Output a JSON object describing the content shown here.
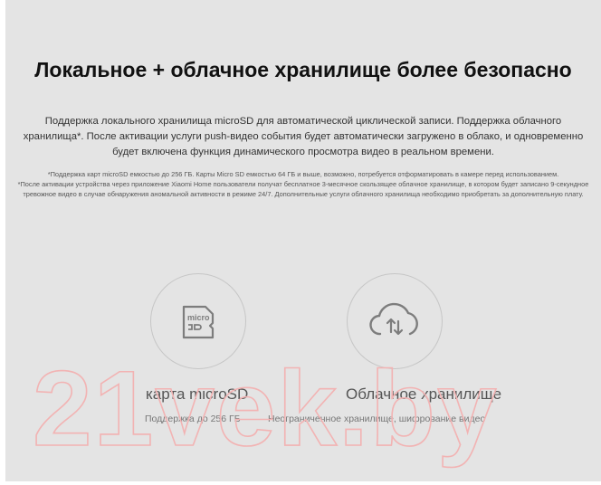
{
  "heading": "Локальное + облачное хранилище более безопасно",
  "description": "Поддержка локального хранилища microSD для автоматической циклической записи. Поддержка облачного хранилища*. После активации услуги push-видео события будет автоматически загружено в облако, и одновременно будет включена функция динамического просмотра видео в реальном времени.",
  "footnotes": [
    "*Поддержка карт microSD емкостью до 256 ГБ. Карты Micro SD емкостью 64 ГБ и выше, возможно, потребуется отформатировать в камере перед использованием.",
    "*После активации устройства через приложение Xiaomi Home пользователи получат бесплатное 3-месячное скользящее облачное хранилище, в котором будет записано 9-секундное тревожное видео в случае обнаружения аномальной активности в режиме 24/7. Дополнительные услуги облачного хранилища необходимо приобретать за дополнительную плату."
  ],
  "features": [
    {
      "icon": "microsd-card-icon",
      "icon_text": "micro",
      "title": "карта microSD",
      "subtitle": "Поддержка до 256 ГБ"
    },
    {
      "icon": "cloud-sync-icon",
      "title": "Облачное хранилище",
      "subtitle": "Неограниченное хранилище, шифрование видео"
    }
  ],
  "watermark": "21vek.by",
  "colors": {
    "panel_background": "#e4e4e4",
    "heading": "#111111",
    "watermark_outline": "#f2b3b3"
  }
}
